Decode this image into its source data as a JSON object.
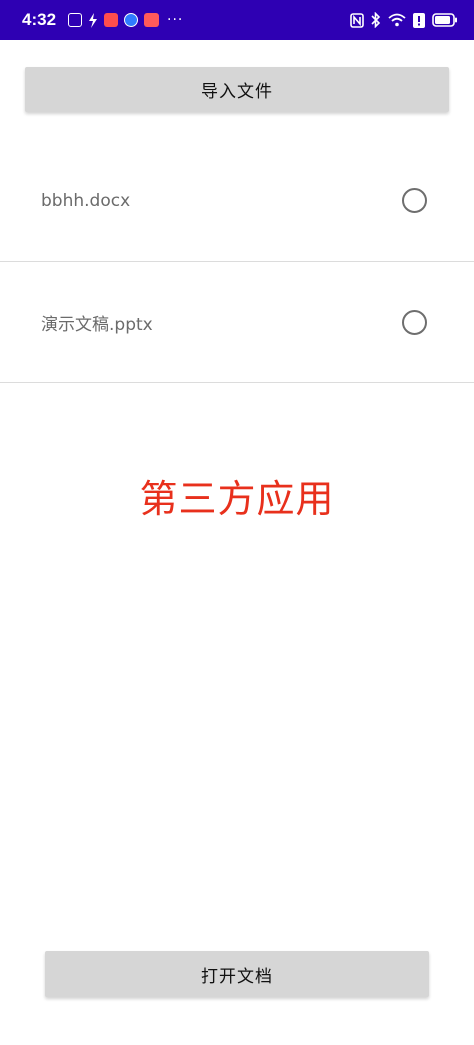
{
  "status_bar": {
    "time": "4:32",
    "more": "···",
    "notification_icons": [
      "hd-icon",
      "charging-icon",
      "red-app-icon",
      "browser-icon",
      "red-app-icon-2"
    ],
    "right_icons": [
      "nfc-icon",
      "bluetooth-icon",
      "wifi-icon",
      "alert-icon",
      "battery-icon"
    ]
  },
  "toolbar": {
    "import_label": "导入文件"
  },
  "files": [
    {
      "name": "bbhh.docx",
      "selected": false
    },
    {
      "name": "演示文稿.pptx",
      "selected": false
    }
  ],
  "center_label": "第三方应用",
  "footer": {
    "open_label": "打开文档"
  },
  "colors": {
    "status_bar": "#2e00b3",
    "button_bg": "#d6d6d6",
    "label_red": "#e8301c",
    "file_text": "#6b6b6b"
  }
}
